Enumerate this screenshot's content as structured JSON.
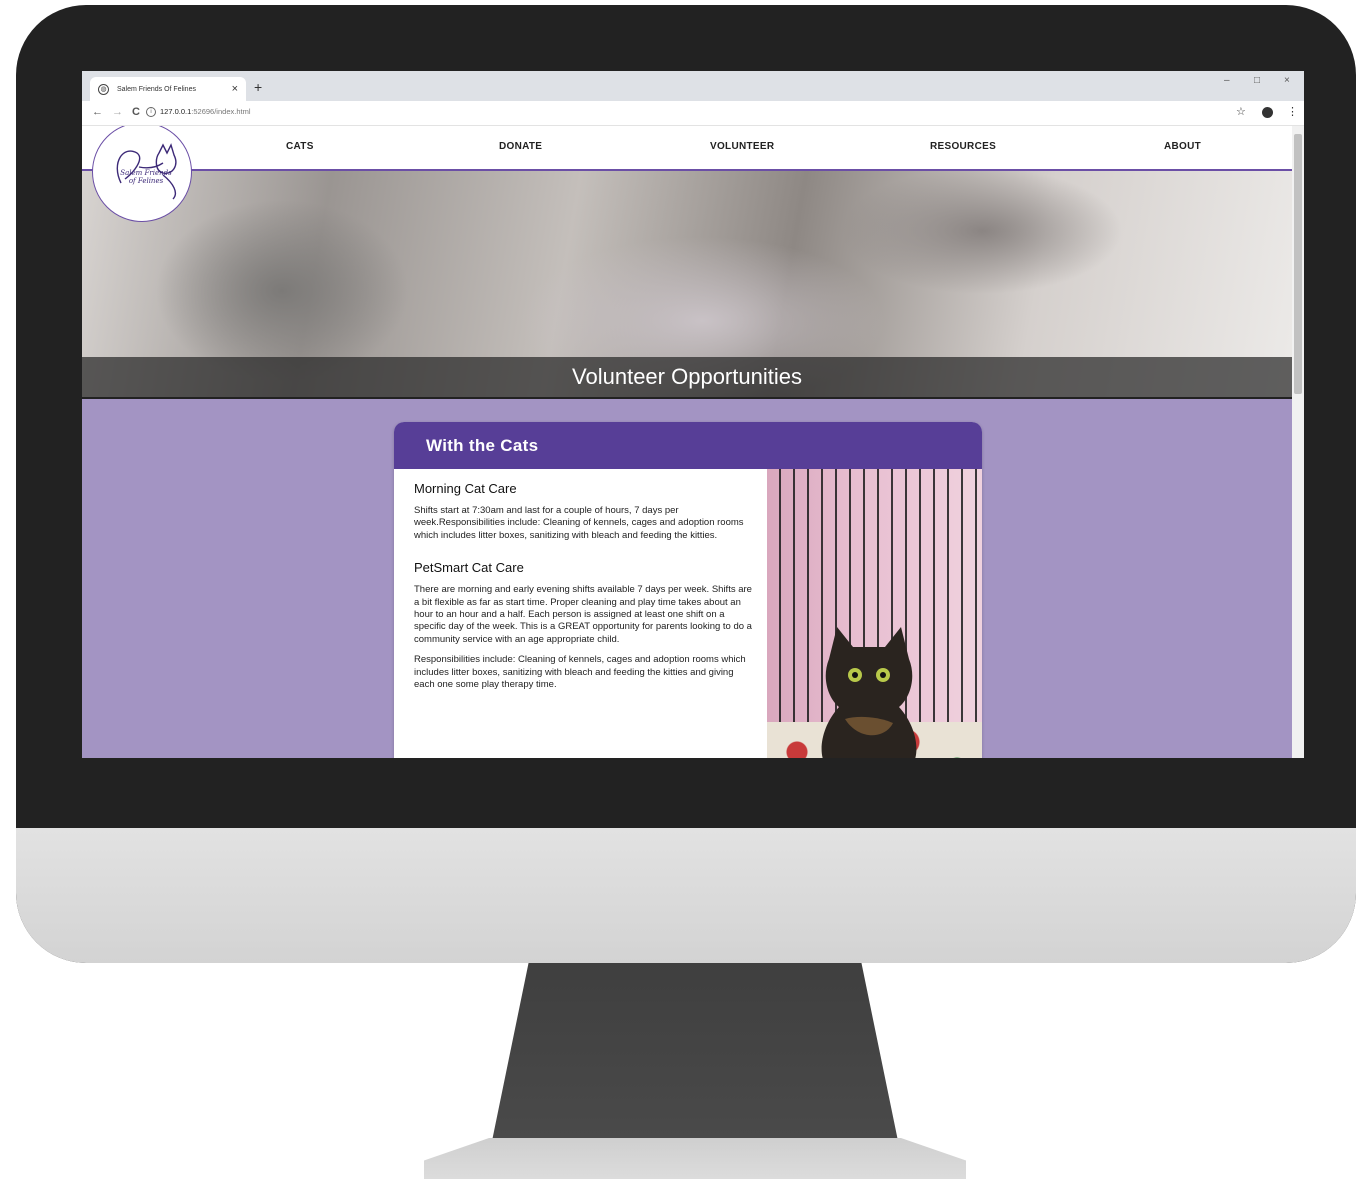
{
  "browser": {
    "tab_title": "Salem Friends Of Felines",
    "tab_close": "×",
    "new_tab": "+",
    "window_controls": {
      "minimize": "–",
      "maximize": "□",
      "close": "×"
    },
    "back": "←",
    "forward": "→",
    "reload": "C",
    "url_host": "127.0.0.1",
    "url_path": ":52696/index.html",
    "bookmark_star": "☆",
    "menu": "⋮"
  },
  "site": {
    "logo_text_line1": "Salem Friends",
    "logo_text_line2": "of Felines",
    "nav": [
      {
        "label": "CATS"
      },
      {
        "label": "DONATE"
      },
      {
        "label": "VOLUNTEER"
      },
      {
        "label": "RESOURCES"
      },
      {
        "label": "ABOUT"
      }
    ],
    "hero_title": "Volunteer Opportunities",
    "accent_color": "#573e97",
    "page_background": "#a394c3"
  },
  "card": {
    "title": "With the Cats",
    "sections": [
      {
        "title": "Morning Cat Care",
        "paragraphs": [
          "Shifts start at 7:30am and last for a couple of hours, 7 days per week.Responsibilities include: Cleaning of kennels, cages and adoption rooms which includes litter boxes, sanitizing with bleach and feeding the kitties."
        ]
      },
      {
        "title": "PetSmart Cat Care",
        "paragraphs": [
          "There are morning and early evening shifts available 7 days per week. Shifts are a bit flexible as far as start time. Proper cleaning and play time takes about an hour to an hour and a half. Each person is assigned at least one shift on a specific day of the week. This is a GREAT opportunity for parents looking to do a community service with an age appropriate child.",
          "Responsibilities include: Cleaning of kennels, cages and adoption rooms which includes litter boxes, sanitizing with bleach and feeding the kitties and giving each one some play therapy time."
        ]
      }
    ]
  }
}
